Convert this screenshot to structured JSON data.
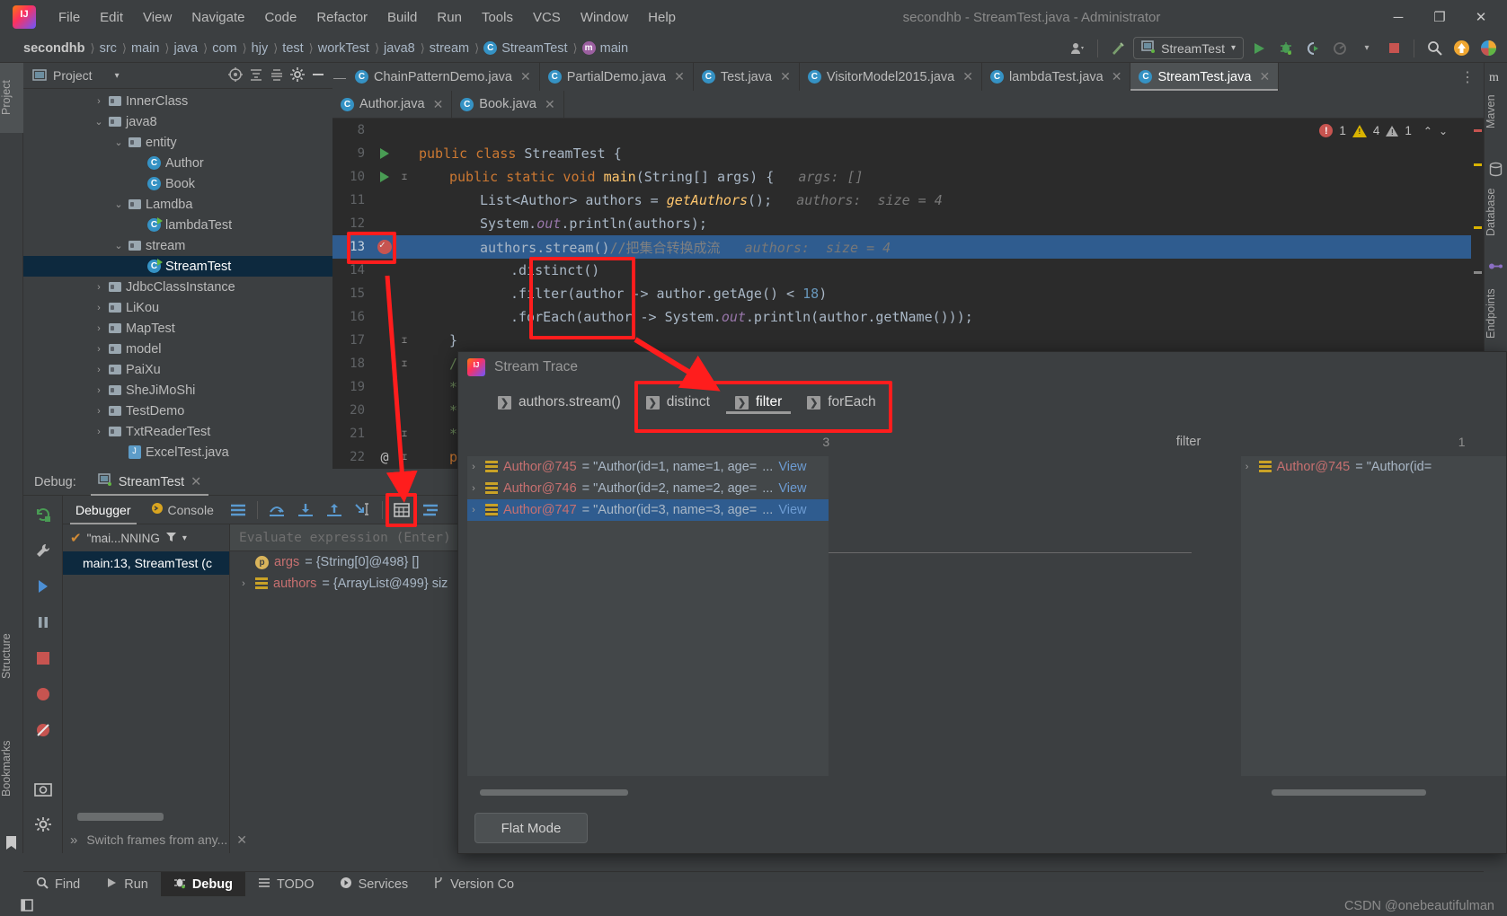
{
  "window": {
    "title": "secondhb - StreamTest.java - Administrator",
    "logo": "intellij-logo",
    "minimize": "─",
    "maximize": "❐",
    "close": "✕"
  },
  "menu": [
    "File",
    "Edit",
    "View",
    "Navigate",
    "Code",
    "Refactor",
    "Build",
    "Run",
    "Tools",
    "VCS",
    "Window",
    "Help"
  ],
  "breadcrumb": [
    {
      "label": "secondhb",
      "icon": ""
    },
    {
      "label": "src",
      "icon": ""
    },
    {
      "label": "main",
      "icon": ""
    },
    {
      "label": "java",
      "icon": ""
    },
    {
      "label": "com",
      "icon": ""
    },
    {
      "label": "hjy",
      "icon": ""
    },
    {
      "label": "test",
      "icon": ""
    },
    {
      "label": "workTest",
      "icon": ""
    },
    {
      "label": "java8",
      "icon": ""
    },
    {
      "label": "stream",
      "icon": ""
    },
    {
      "label": "StreamTest",
      "icon": "class-icon"
    },
    {
      "label": "main",
      "icon": "method-icon"
    }
  ],
  "toolbar": {
    "run_config": "StreamTest",
    "run_label": "run-icon",
    "debug_label": "debug-icon",
    "coverage_label": "coverage-icon",
    "profile_label": "profile-icon",
    "stop_label": "stop-icon",
    "search_label": "search-icon",
    "update_label": "update-icon",
    "avatar_label": "user-icon",
    "hammer_label": "build-icon"
  },
  "left_strip": [
    {
      "label": "Project",
      "selected": true
    },
    {
      "label": "Structure",
      "selected": false
    },
    {
      "label": "Bookmarks",
      "selected": false
    }
  ],
  "right_strip": [
    {
      "label": "Maven"
    },
    {
      "label": "Database"
    },
    {
      "label": "Endpoints"
    }
  ],
  "project_panel": {
    "title": "Project",
    "chevron": "▾",
    "actions": [
      "target-icon",
      "collapse-icon",
      "expand-icon",
      "gear-icon",
      "hide-icon"
    ],
    "tree": [
      {
        "label": "InnerClass",
        "depth": 3,
        "arrow": "›",
        "icon": "folder-icon",
        "selected": false
      },
      {
        "label": "java8",
        "depth": 3,
        "arrow": "⌄",
        "icon": "folder-icon",
        "selected": false
      },
      {
        "label": "entity",
        "depth": 4,
        "arrow": "⌄",
        "icon": "folder-icon",
        "selected": false
      },
      {
        "label": "Author",
        "depth": 5,
        "arrow": "",
        "icon": "class-icon",
        "selected": false
      },
      {
        "label": "Book",
        "depth": 5,
        "arrow": "",
        "icon": "class-icon",
        "selected": false
      },
      {
        "label": "Lamdba",
        "depth": 4,
        "arrow": "⌄",
        "icon": "folder-icon",
        "selected": false
      },
      {
        "label": "lambdaTest",
        "depth": 5,
        "arrow": "",
        "icon": "runnable-class-icon",
        "selected": false
      },
      {
        "label": "stream",
        "depth": 4,
        "arrow": "⌄",
        "icon": "folder-icon",
        "selected": false
      },
      {
        "label": "StreamTest",
        "depth": 5,
        "arrow": "",
        "icon": "runnable-class-icon",
        "selected": true
      },
      {
        "label": "JdbcClassInstance",
        "depth": 3,
        "arrow": "›",
        "icon": "folder-icon",
        "selected": false
      },
      {
        "label": "LiKou",
        "depth": 3,
        "arrow": "›",
        "icon": "folder-icon",
        "selected": false
      },
      {
        "label": "MapTest",
        "depth": 3,
        "arrow": "›",
        "icon": "folder-icon",
        "selected": false
      },
      {
        "label": "model",
        "depth": 3,
        "arrow": "›",
        "icon": "folder-icon",
        "selected": false
      },
      {
        "label": "PaiXu",
        "depth": 3,
        "arrow": "›",
        "icon": "folder-icon",
        "selected": false
      },
      {
        "label": "SheJiMoShi",
        "depth": 3,
        "arrow": "›",
        "icon": "folder-icon",
        "selected": false
      },
      {
        "label": "TestDemo",
        "depth": 3,
        "arrow": "›",
        "icon": "folder-icon",
        "selected": false
      },
      {
        "label": "TxtReaderTest",
        "depth": 3,
        "arrow": "›",
        "icon": "folder-icon",
        "selected": false
      },
      {
        "label": "ExcelTest.java",
        "depth": 4,
        "arrow": "",
        "icon": "java-file-icon",
        "selected": false
      }
    ]
  },
  "editor": {
    "tabs_row1": [
      {
        "label": "ChainPatternDemo.java",
        "active": false
      },
      {
        "label": "PartialDemo.java",
        "active": false
      },
      {
        "label": "Test.java",
        "active": false
      },
      {
        "label": "VisitorModel2015.java",
        "active": false
      },
      {
        "label": "lambdaTest.java",
        "active": false
      },
      {
        "label": "StreamTest.java",
        "active": true
      }
    ],
    "tabs_row2": [
      {
        "label": "Author.java",
        "active": false
      },
      {
        "label": "Book.java",
        "active": false
      }
    ],
    "close_glyph": "✕",
    "more_glyph": "⋮",
    "inspections": {
      "errors": "1",
      "warnings": "4",
      "weak": "1",
      "up": "⌃",
      "down": "⌄"
    },
    "lines": [
      {
        "no": "8",
        "marker": "",
        "fold": "",
        "segs": []
      },
      {
        "no": "9",
        "marker": "run-gutter-icon",
        "fold": "",
        "segs": [
          {
            "t": "public class ",
            "c": "kw"
          },
          {
            "t": "StreamTest ",
            "c": "plain"
          },
          {
            "t": "{",
            "c": "plain"
          }
        ],
        "indent": 0
      },
      {
        "no": "10",
        "marker": "run-gutter-icon",
        "fold": "⌶",
        "segs": [
          {
            "t": "public static void ",
            "c": "kw"
          },
          {
            "t": "main",
            "c": "mtd"
          },
          {
            "t": "(String[] args) {",
            "c": "plain"
          },
          {
            "t": "   args: []",
            "c": "hint"
          }
        ],
        "indent": 1
      },
      {
        "no": "11",
        "marker": "",
        "fold": "",
        "segs": [
          {
            "t": "List<Author> authors = ",
            "c": "plain"
          },
          {
            "t": "getAuthors",
            "c": "mtd-i"
          },
          {
            "t": "();",
            "c": "plain"
          },
          {
            "t": "   authors:  size = 4",
            "c": "hint"
          }
        ],
        "indent": 2
      },
      {
        "no": "12",
        "marker": "",
        "fold": "",
        "segs": [
          {
            "t": "System.",
            "c": "plain"
          },
          {
            "t": "out",
            "c": "fld"
          },
          {
            "t": ".println(authors);",
            "c": "plain"
          }
        ],
        "indent": 2
      },
      {
        "no": "13",
        "marker": "breakpoint-verified-icon",
        "fold": "",
        "highlight": true,
        "segs": [
          {
            "t": "authors.stream()",
            "c": "plain"
          },
          {
            "t": "//把集合转换成流",
            "c": "cmt"
          },
          {
            "t": "   authors:  size = 4",
            "c": "hint"
          }
        ],
        "indent": 2
      },
      {
        "no": "14",
        "marker": "",
        "fold": "",
        "segs": [
          {
            "t": ".distinct()",
            "c": "plain"
          }
        ],
        "indent": 3
      },
      {
        "no": "15",
        "marker": "",
        "fold": "",
        "segs": [
          {
            "t": ".filter(author -> author.",
            "c": "plain"
          },
          {
            "t": "getAge",
            "c": "mtd2"
          },
          {
            "t": "() < ",
            "c": "plain"
          },
          {
            "t": "18",
            "c": "num"
          },
          {
            "t": ")",
            "c": "plain"
          }
        ],
        "indent": 3
      },
      {
        "no": "16",
        "marker": "",
        "fold": "",
        "segs": [
          {
            "t": ".forEach(author -> System.",
            "c": "plain"
          },
          {
            "t": "out",
            "c": "fld"
          },
          {
            "t": ".println(author.",
            "c": "plain"
          },
          {
            "t": "getName",
            "c": "mtd2"
          },
          {
            "t": "()));",
            "c": "plain"
          }
        ],
        "indent": 3
      },
      {
        "no": "17",
        "marker": "",
        "fold": "⌶",
        "segs": [
          {
            "t": "}",
            "c": "plain"
          }
        ],
        "indent": 1
      },
      {
        "no": "18",
        "marker": "",
        "fold": "⌶",
        "segs": [
          {
            "t": "/**",
            "c": "cmt-doc"
          }
        ],
        "indent": 1
      },
      {
        "no": "19",
        "marker": "",
        "fold": "",
        "segs": [
          {
            "t": "*",
            "c": "cmt-doc"
          }
        ],
        "indent": 1
      },
      {
        "no": "20",
        "marker": "",
        "fold": "",
        "segs": [
          {
            "t": "*",
            "c": "cmt-doc"
          }
        ],
        "indent": 1
      },
      {
        "no": "21",
        "marker": "",
        "fold": "⌶",
        "segs": [
          {
            "t": "*/",
            "c": "cmt-doc"
          }
        ],
        "indent": 1
      },
      {
        "no": "22",
        "marker": "annotation-gutter-icon",
        "fold": "⌶",
        "segs": [
          {
            "t": "pub",
            "c": "kw"
          }
        ],
        "indent": 1
      }
    ]
  },
  "debug": {
    "label": "Debug:",
    "session_tab": "StreamTest",
    "close_glyph": "✕",
    "tabs": [
      {
        "label": "Debugger",
        "active": true
      },
      {
        "label": "Console",
        "active": false
      }
    ],
    "toolbar_icons": [
      "rerun-icon",
      "settings-icon",
      "mute-icon",
      "layout-icon",
      "step-over-icon",
      "step-into-icon",
      "step-out-icon",
      "run-to-cursor-icon",
      "evaluate-icon",
      "stream-trace-icon"
    ],
    "frame_filter": "\"mai...NNING",
    "frame": "main:13, StreamTest (c",
    "evaluate_placeholder": "Evaluate expression (Enter)",
    "variables": [
      {
        "name": "args",
        "value": "= {String[0]@498} []",
        "icon": "parameter-icon",
        "caret": ""
      },
      {
        "name": "authors",
        "value": "= {ArrayList@499}  siz",
        "icon": "list-icon",
        "caret": "›"
      }
    ],
    "bottom_hint": "Switch frames from any...",
    "bottom_hint_close": "✕",
    "bottom_hint_more": "»"
  },
  "status_bar": {
    "items": [
      {
        "label": "Find",
        "icon": "search-icon",
        "active": false
      },
      {
        "label": "Run",
        "icon": "run-icon",
        "active": false
      },
      {
        "label": "Debug",
        "icon": "debug-icon",
        "active": true
      },
      {
        "label": "TODO",
        "icon": "todo-icon",
        "active": false
      },
      {
        "label": "Services",
        "icon": "services-icon",
        "active": false
      },
      {
        "label": "Version Co",
        "icon": "vcs-icon",
        "active": false
      }
    ]
  },
  "stream_trace": {
    "title": "Stream Trace",
    "tabs": [
      {
        "label": "authors.stream()",
        "active": false,
        "boxed": false
      },
      {
        "label": "distinct",
        "active": false,
        "boxed": true
      },
      {
        "label": "filter",
        "active": true,
        "boxed": true
      },
      {
        "label": "forEach",
        "active": false,
        "boxed": true
      }
    ],
    "chev_glyph": "❯",
    "left_pane": {
      "count": "3",
      "rows": [
        {
          "name": "Author@745",
          "value": "= \"Author(id=1, name=1, age=",
          "ellipsis": "...",
          "view": "View",
          "selected": false
        },
        {
          "name": "Author@746",
          "value": "= \"Author(id=2, name=2, age=",
          "ellipsis": "...",
          "view": "View",
          "selected": false
        },
        {
          "name": "Author@747",
          "value": "= \"Author(id=3, name=3, age=",
          "ellipsis": "...",
          "view": "View",
          "selected": true
        }
      ]
    },
    "right_pane": {
      "label": "filter",
      "count": "1",
      "rows": [
        {
          "name": "Author@745",
          "value": "= \"Author(id=",
          "selected": false
        }
      ]
    },
    "footer_button": "Flat Mode"
  },
  "watermark": "CSDN @onebeautifulman",
  "colors": {
    "accent_blue": "#2f5c8f",
    "annotation_red": "#ff1d1d",
    "editor_bg": "#2b2b2b",
    "panel_bg": "#3c3f41",
    "selection_tree": "#0d293e"
  }
}
